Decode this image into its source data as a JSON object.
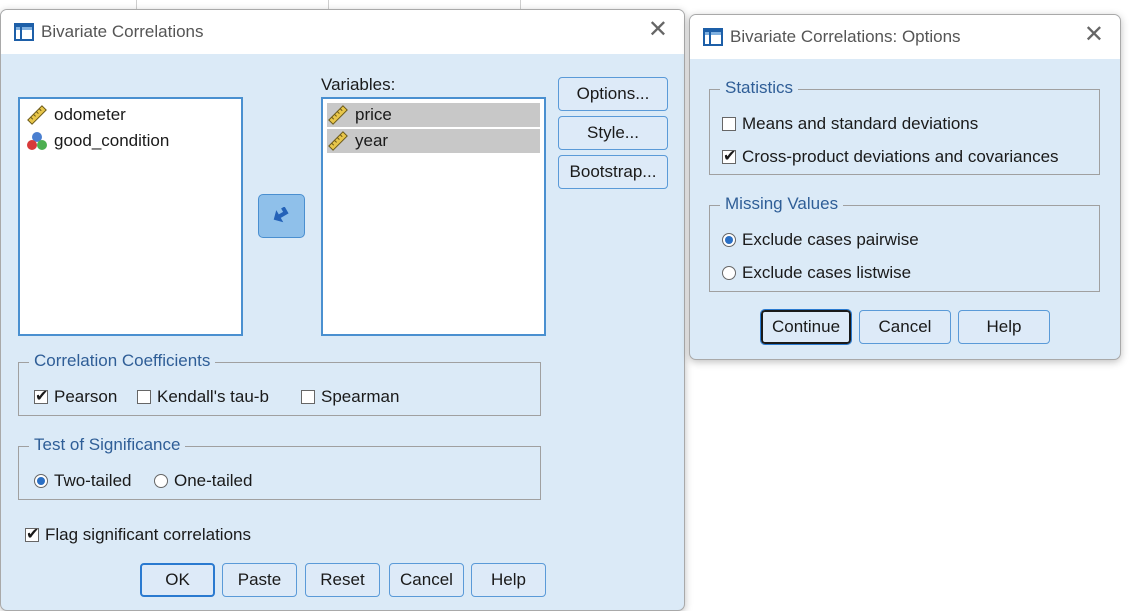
{
  "main_dialog": {
    "title": "Bivariate Correlations",
    "source_list": [
      {
        "name": "odometer",
        "icon": "scale-ruler-icon"
      },
      {
        "name": "good_condition",
        "icon": "nominal-balls-icon"
      }
    ],
    "variables_label": "Variables:",
    "variables": [
      {
        "name": "price",
        "icon": "scale-ruler-icon"
      },
      {
        "name": "year",
        "icon": "scale-ruler-icon"
      }
    ],
    "side_buttons": {
      "options": "Options...",
      "style": "Style...",
      "bootstrap": "Bootstrap..."
    },
    "correlation_coefficients": {
      "legend": "Correlation Coefficients",
      "pearson": {
        "label": "Pearson",
        "checked": true
      },
      "kendall": {
        "label": "Kendall's tau-b",
        "checked": false
      },
      "spearman": {
        "label": "Spearman",
        "checked": false
      }
    },
    "test_of_significance": {
      "legend": "Test of Significance",
      "two_tailed": {
        "label": "Two-tailed",
        "selected": true
      },
      "one_tailed": {
        "label": "One-tailed",
        "selected": false
      }
    },
    "flag_significant": {
      "label": "Flag significant correlations",
      "checked": true
    },
    "buttons": {
      "ok": "OK",
      "paste": "Paste",
      "reset": "Reset",
      "cancel": "Cancel",
      "help": "Help"
    }
  },
  "options_dialog": {
    "title": "Bivariate Correlations: Options",
    "statistics": {
      "legend": "Statistics",
      "means": {
        "label": "Means and standard deviations",
        "checked": false
      },
      "cross_product": {
        "label": "Cross-product deviations and covariances",
        "checked": true
      }
    },
    "missing_values": {
      "legend": "Missing Values",
      "pairwise": {
        "label": "Exclude cases pairwise",
        "selected": true
      },
      "listwise": {
        "label": "Exclude cases listwise",
        "selected": false
      }
    },
    "buttons": {
      "continue": "Continue",
      "cancel": "Cancel",
      "help": "Help"
    }
  },
  "colors": {
    "dialog_bg": "#dbeaf7",
    "accent": "#2a7ad0",
    "legend_text": "#2f5e97"
  }
}
